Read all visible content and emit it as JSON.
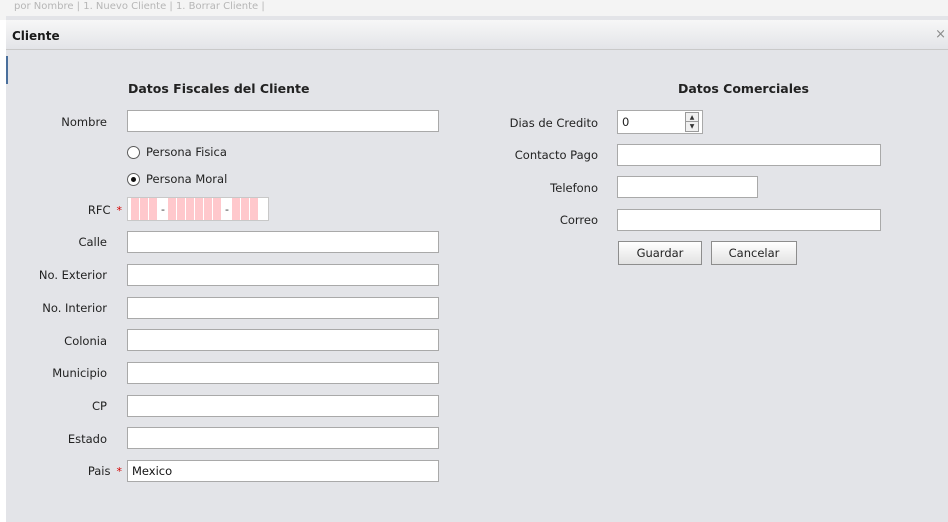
{
  "background": {
    "text": "por Nombre    | 1. Nuevo Cliente  | 1. Borrar Cliente  |"
  },
  "dialog": {
    "title": "Cliente",
    "close_symbol": "×"
  },
  "fiscal": {
    "heading": "Datos Fiscales del Cliente",
    "nombre": {
      "label": "Nombre",
      "value": ""
    },
    "radios": {
      "fisica": {
        "label": "Persona Fisica",
        "selected": false
      },
      "moral": {
        "label": "Persona Moral",
        "selected": true
      }
    },
    "rfc": {
      "label": "RFC",
      "required_marker": "*",
      "separator": "-"
    },
    "calle": {
      "label": "Calle",
      "value": ""
    },
    "no_exterior": {
      "label": "No. Exterior",
      "value": ""
    },
    "no_interior": {
      "label": "No. Interior",
      "value": ""
    },
    "colonia": {
      "label": "Colonia",
      "value": ""
    },
    "municipio": {
      "label": "Municipio",
      "value": ""
    },
    "cp": {
      "label": "CP",
      "value": ""
    },
    "estado": {
      "label": "Estado",
      "value": ""
    },
    "pais": {
      "label": "Pais",
      "required_marker": "*",
      "value": "Mexico"
    }
  },
  "comercial": {
    "heading": "Datos Comerciales",
    "dias_credito": {
      "label": "Dias de Credito",
      "value": "0"
    },
    "contacto_pago": {
      "label": "Contacto Pago",
      "value": ""
    },
    "telefono": {
      "label": "Telefono",
      "value": ""
    },
    "correo": {
      "label": "Correo",
      "value": ""
    },
    "guardar_label": "Guardar",
    "cancelar_label": "Cancelar"
  },
  "colors": {
    "required": "#d40000",
    "rfc_segment": "#ffc8cc",
    "dialog_bg": "#e3e4e8"
  }
}
